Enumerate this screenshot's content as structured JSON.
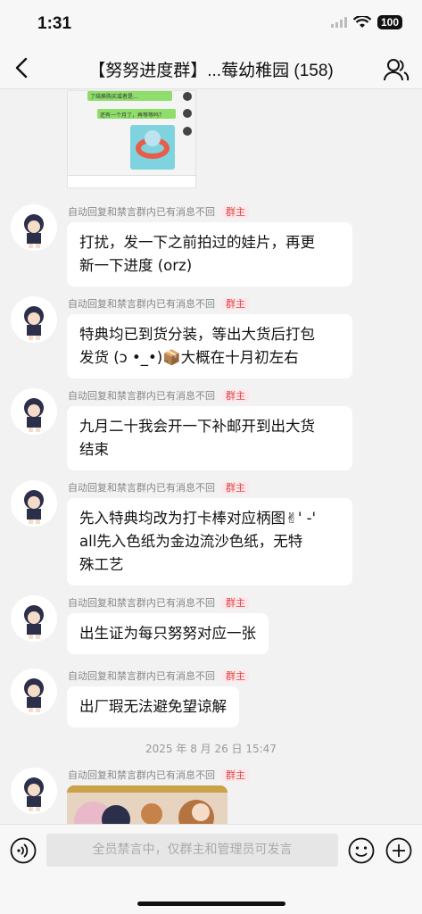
{
  "status_bar": {
    "time": "1:31",
    "battery": "100"
  },
  "header": {
    "title": "【努努进度群】...莓幼稚园 (158)"
  },
  "screenshot_preview": {
    "lines": [
      "了结换购买或者是...",
      "还有一个月了，再等等吗？"
    ]
  },
  "messages": [
    {
      "meta": "自动回复和禁言群内已有消息不回",
      "badge": "群主",
      "lines": [
        "打扰，发一下之前拍过的娃片，再更",
        "新一下进度 (orz)"
      ]
    },
    {
      "meta": "自动回复和禁言群内已有消息不回",
      "badge": "群主",
      "lines": [
        "特典均已到货分装，等出大货后打包",
        "发货 (ↄ •_•)📦大概在十月初左右"
      ]
    },
    {
      "meta": "自动回复和禁言群内已有消息不回",
      "badge": "群主",
      "lines": [
        "九月二十我会开一下补邮开到出大货",
        "结束"
      ]
    },
    {
      "meta": "自动回复和禁言群内已有消息不回",
      "badge": "群主",
      "lines": [
        "先入特典均改为打卡棒对应柄图✌' -'",
        "all先入色纸为金边流沙色纸，无特",
        "殊工艺"
      ]
    },
    {
      "meta": "自动回复和禁言群内已有消息不回",
      "badge": "群主",
      "lines": [
        "出生证为每只努努对应一张"
      ]
    },
    {
      "meta": "自动回复和禁言群内已有消息不回",
      "badge": "群主",
      "lines": [
        "出厂瑕无法避免望谅解"
      ]
    },
    {
      "meta": "自动回复和禁言群内已有消息不回",
      "badge": "群主",
      "lines": []
    }
  ],
  "timestamp": "2025 年 8 月 26 日 15:47",
  "input": {
    "placeholder": "全员禁言中，仅群主和管理员可发言"
  }
}
